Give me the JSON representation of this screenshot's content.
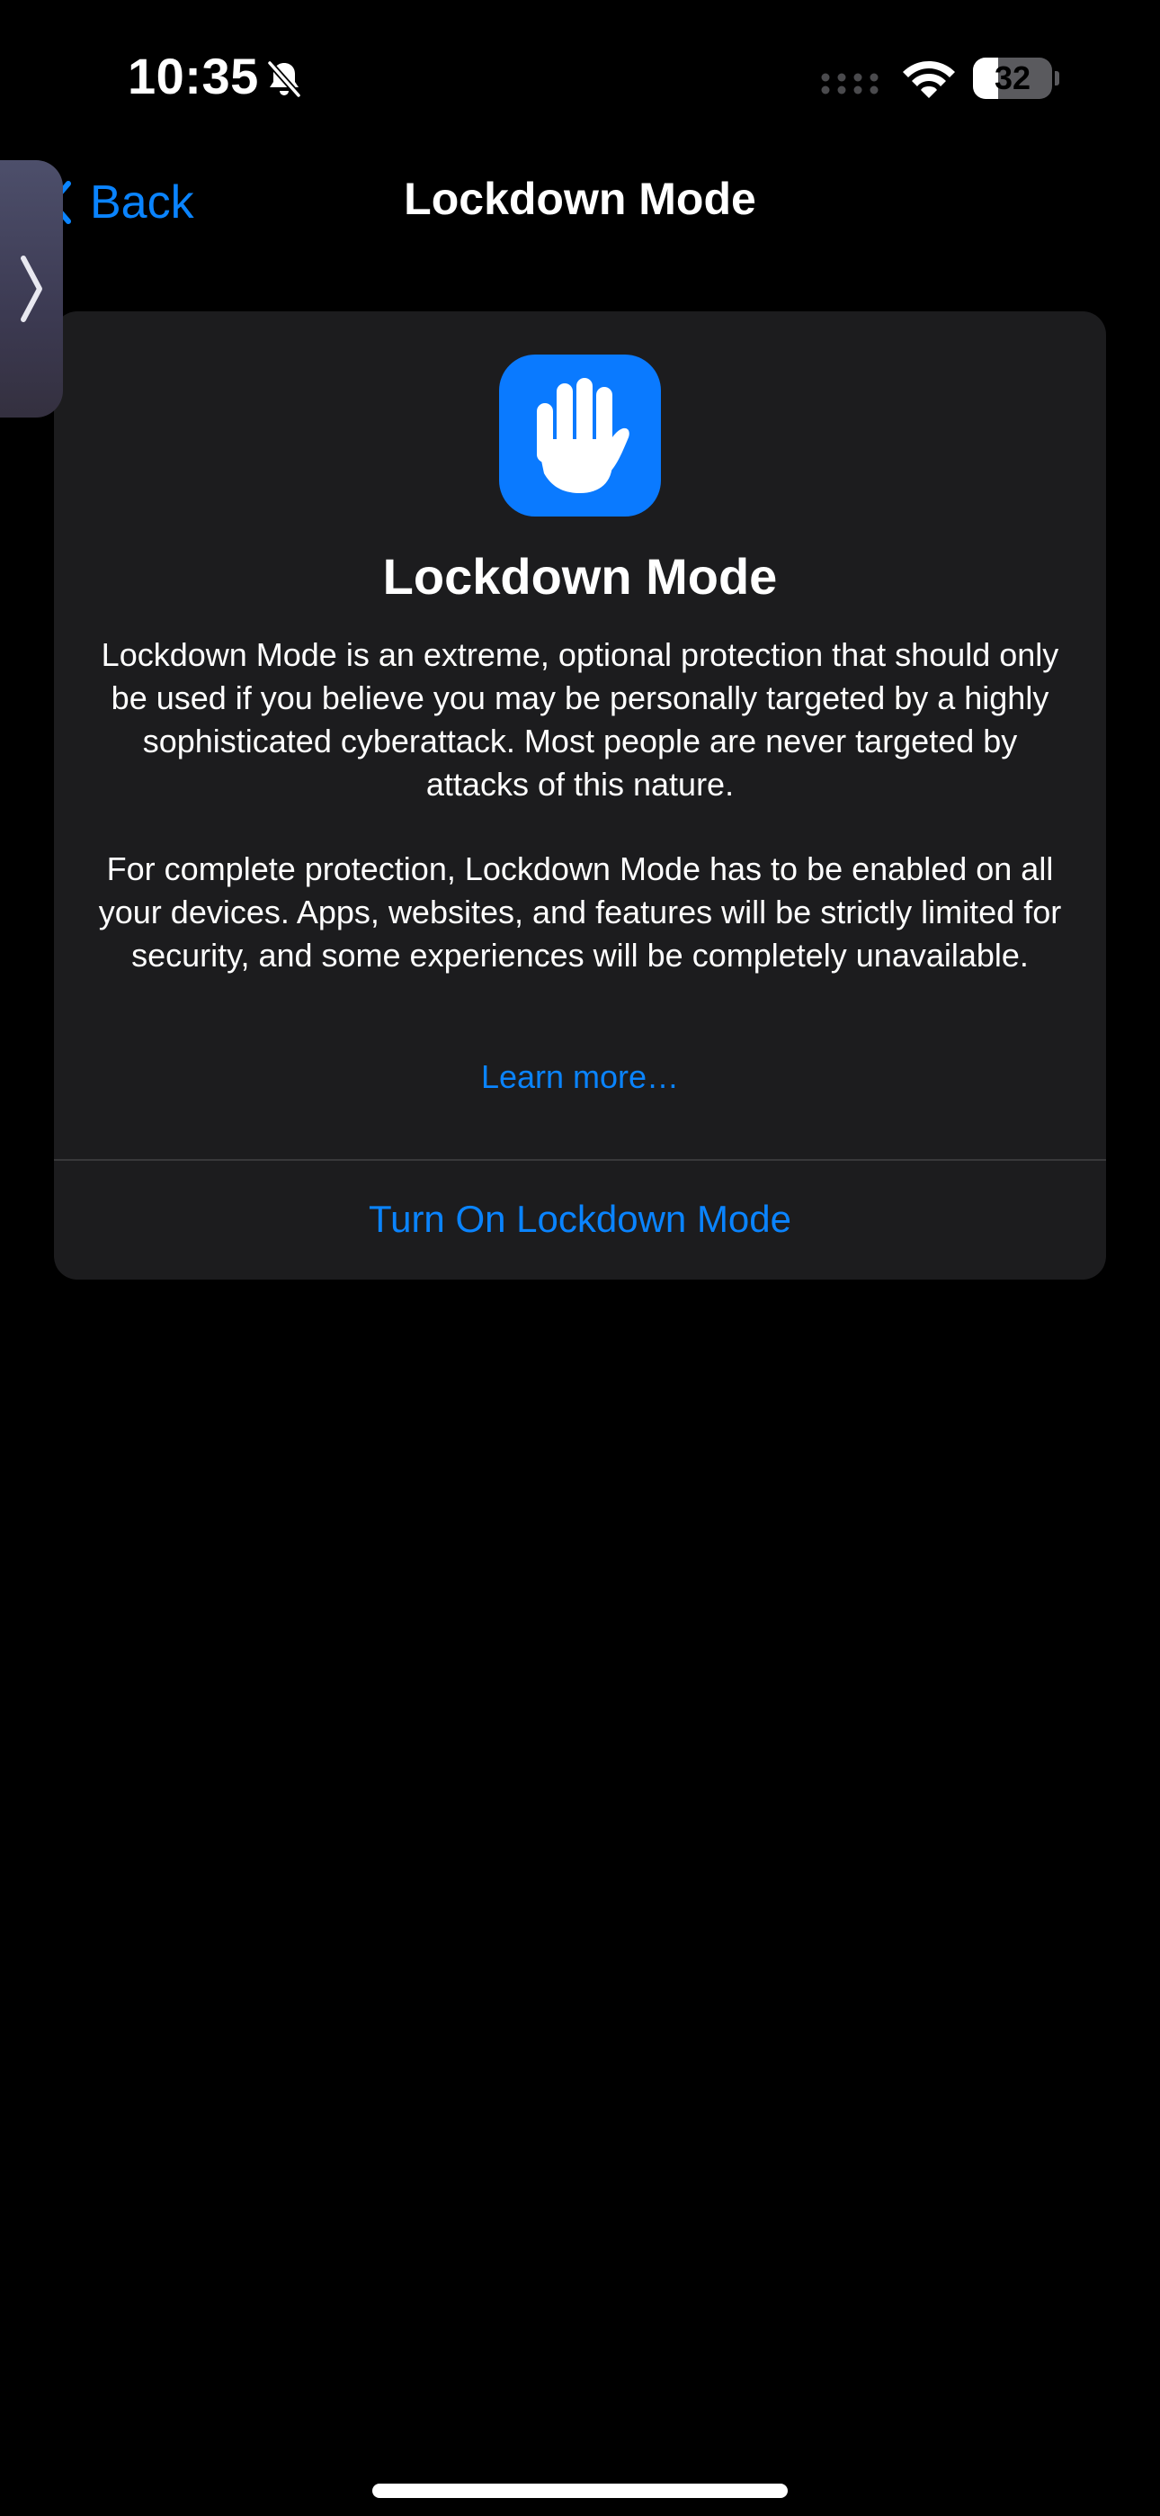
{
  "status_bar": {
    "time": "10:35",
    "battery_level": "32",
    "battery_fraction": 0.32,
    "icons": [
      "bell-slash-icon",
      "cellular-signal-icon",
      "wifi-icon",
      "battery-icon"
    ]
  },
  "nav": {
    "back_label": "Back",
    "title": "Lockdown Mode"
  },
  "card": {
    "icon": "raised-hand-icon",
    "title": "Lockdown Mode",
    "description_1": "Lockdown Mode is an extreme, optional protection that should only be used if you believe you may be personally targeted by a highly sophisticated cyberattack. Most people are never targeted by attacks of this nature.",
    "description_2": "For complete protection, Lockdown Mode has to be enabled on all your devices. Apps, websites, and features will be strictly limited for security, and some experiences will be completely unavailable.",
    "learn_more": "Learn more…",
    "action_label": "Turn On Lockdown Mode"
  },
  "colors": {
    "accent": "#0a84ff",
    "icon_tile": "#0a7aff",
    "card_background": "#1c1c1e",
    "background": "#000000"
  }
}
